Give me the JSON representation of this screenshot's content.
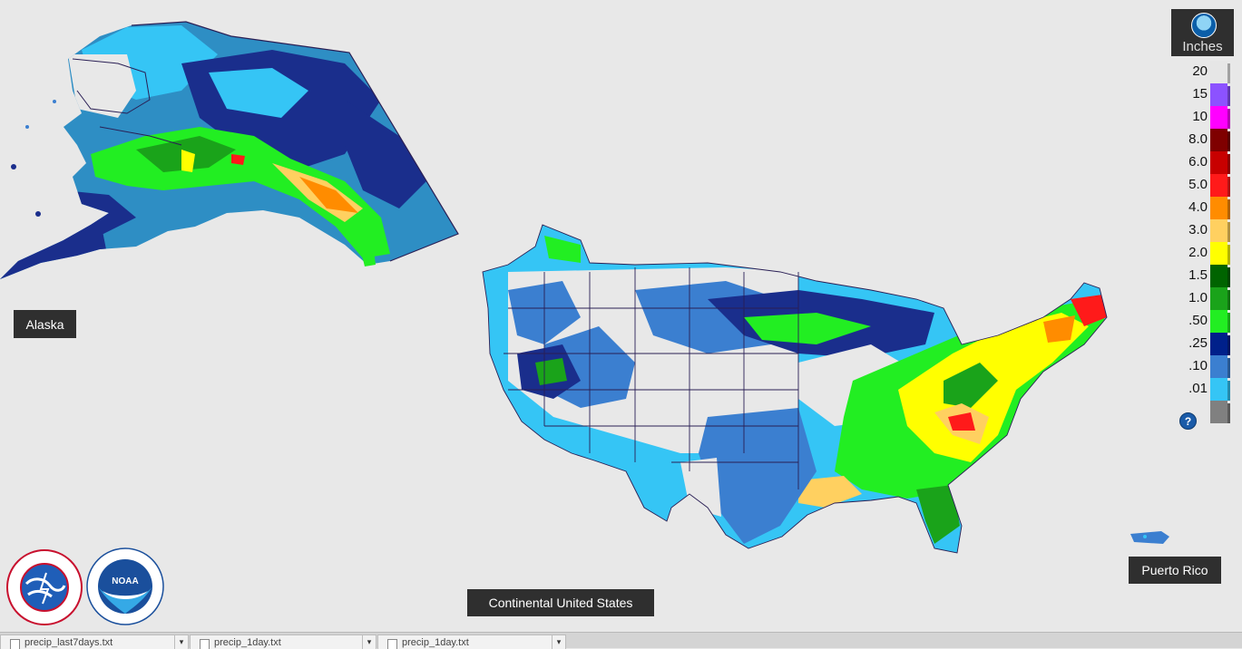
{
  "map": {
    "regions": {
      "alaska": "Alaska",
      "conus": "Continental United States",
      "puerto_rico": "Puerto Rico"
    }
  },
  "legend": {
    "unit": "Inches",
    "items": [
      {
        "label": "20",
        "color": "#e6e6e6"
      },
      {
        "label": "15",
        "color": "#8c52ff"
      },
      {
        "label": "10",
        "color": "#ff00ff"
      },
      {
        "label": "8.0",
        "color": "#7f0000"
      },
      {
        "label": "6.0",
        "color": "#c80000"
      },
      {
        "label": "5.0",
        "color": "#ff1a1a"
      },
      {
        "label": "4.0",
        "color": "#ff8c00"
      },
      {
        "label": "3.0",
        "color": "#ffd060"
      },
      {
        "label": "2.0",
        "color": "#ffff00"
      },
      {
        "label": "1.5",
        "color": "#006400"
      },
      {
        "label": "1.0",
        "color": "#1aa31a"
      },
      {
        "label": ".50",
        "color": "#22ee22"
      },
      {
        "label": ".25",
        "color": "#00208a"
      },
      {
        "label": ".10",
        "color": "#3b7fd0"
      },
      {
        "label": ".01",
        "color": "#35c5f5"
      },
      {
        "label": "",
        "color": "#808080"
      }
    ],
    "help": "?"
  },
  "downloads": [
    {
      "name": "precip_last7days.txt"
    },
    {
      "name": "precip_1day.txt"
    },
    {
      "name": "precip_1day.txt"
    }
  ],
  "logos": {
    "nws": "NATIONAL WEATHER SERVICE",
    "noaa": "NOAA",
    "noaa_ring": "NATIONAL OCEANIC AND ATMOSPHERIC ADMINISTRATION • U.S. DEPARTMENT OF COMMERCE"
  }
}
